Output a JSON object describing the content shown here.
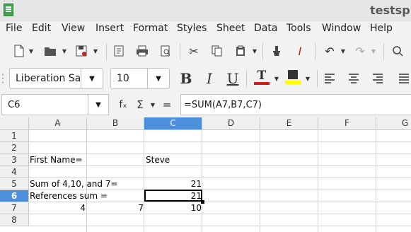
{
  "window": {
    "title": "testspr"
  },
  "menu": [
    "File",
    "Edit",
    "View",
    "Insert",
    "Format",
    "Styles",
    "Sheet",
    "Data",
    "Tools",
    "Window",
    "Help"
  ],
  "toolbar2": {
    "font_name": "Liberation Sa",
    "font_size": "10"
  },
  "formula_bar": {
    "cell_ref": "C6",
    "fx_label": "fₓ",
    "sum_label": "Σ",
    "equals_label": "=",
    "formula": "=SUM(A7,B7,C7)"
  },
  "sheet": {
    "columns": [
      "A",
      "B",
      "C",
      "D",
      "E",
      "F",
      "G"
    ],
    "rows": [
      "1",
      "2",
      "3",
      "4",
      "5",
      "6",
      "7",
      "8"
    ],
    "active_col": "C",
    "active_row": "6",
    "cells": {
      "A3": "First Name=",
      "C3": "Steve",
      "A5": "Sum of 4,10, and 7=",
      "C5": "21",
      "A6": "References sum =",
      "C6": "21",
      "A7": "4",
      "B7": "7",
      "C7": "10"
    }
  },
  "colors": {
    "accent": "#4d8fdb",
    "font_color_bar": "#c9211e",
    "highlight_bar": "#ffff00"
  }
}
